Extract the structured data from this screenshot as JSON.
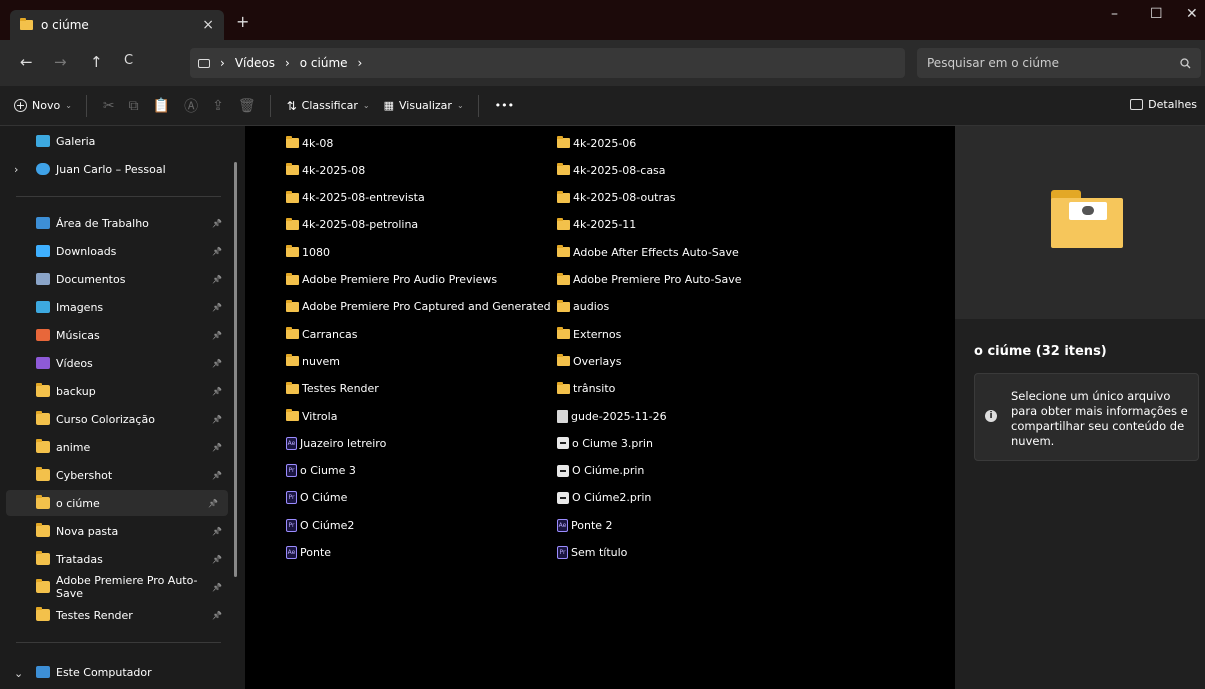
{
  "window": {
    "tab_title": "o ciúme",
    "tab_close": "×",
    "new_tab": "+",
    "minimize": "–",
    "maximize": "☐",
    "close": "✕"
  },
  "address": {
    "back": "←",
    "forward": "→",
    "up": "↑",
    "refresh": "C",
    "crumbs": [
      "Vídeos",
      "o ciúme"
    ],
    "sep": "›",
    "search_placeholder": "Pesquisar em o ciúme"
  },
  "toolbar": {
    "new_label": "Novo",
    "sort_label": "Classificar",
    "view_label": "Visualizar",
    "more_label": "•••",
    "details_label": "Detalhes"
  },
  "sidebar": {
    "gallery": "Galeria",
    "onedrive": "Juan Carlo – Pessoal",
    "pinned": [
      {
        "label": "Área de Trabalho",
        "icon": "desktop-icon",
        "color": "#3d8fd6"
      },
      {
        "label": "Downloads",
        "icon": "download-icon",
        "color": "#3fb0ff"
      },
      {
        "label": "Documentos",
        "icon": "document-icon",
        "color": "#8aa4c8"
      },
      {
        "label": "Imagens",
        "icon": "pictures-icon",
        "color": "#3da9e0"
      },
      {
        "label": "Músicas",
        "icon": "music-icon",
        "color": "#e8673a"
      },
      {
        "label": "Vídeos",
        "icon": "videos-icon",
        "color": "#8e5ad8"
      },
      {
        "label": "backup",
        "icon": "folder-icon",
        "color": "#f3c14b"
      },
      {
        "label": "Curso Colorização",
        "icon": "folder-icon",
        "color": "#f3c14b"
      },
      {
        "label": "anime",
        "icon": "folder-icon",
        "color": "#f3c14b"
      },
      {
        "label": "Cybershot",
        "icon": "folder-icon",
        "color": "#f3c14b"
      },
      {
        "label": "o ciúme",
        "icon": "folder-icon",
        "color": "#f3c14b"
      },
      {
        "label": "Nova pasta",
        "icon": "folder-icon",
        "color": "#f3c14b"
      },
      {
        "label": "Tratadas",
        "icon": "folder-icon",
        "color": "#f3c14b"
      },
      {
        "label": "Adobe Premiere Pro Auto-Save",
        "icon": "folder-icon",
        "color": "#f3c14b"
      },
      {
        "label": "Testes Render",
        "icon": "folder-icon",
        "color": "#f3c14b"
      }
    ],
    "this_pc": "Este Computador"
  },
  "files": {
    "left": [
      {
        "name": "4k-08",
        "type": "folder"
      },
      {
        "name": "4k-2025-08",
        "type": "folder"
      },
      {
        "name": "4k-2025-08-entrevista",
        "type": "folder"
      },
      {
        "name": "4k-2025-08-petrolina",
        "type": "folder"
      },
      {
        "name": "1080",
        "type": "folder"
      },
      {
        "name": "Adobe Premiere Pro Audio Previews",
        "type": "folder"
      },
      {
        "name": "Adobe Premiere Pro Captured and Generated",
        "type": "folder"
      },
      {
        "name": "Carrancas",
        "type": "folder"
      },
      {
        "name": "nuvem",
        "type": "folder"
      },
      {
        "name": "Testes Render",
        "type": "folder"
      },
      {
        "name": "Vitrola",
        "type": "folder"
      },
      {
        "name": "Juazeiro letreiro",
        "type": "ae"
      },
      {
        "name": "o Ciume 3",
        "type": "pr"
      },
      {
        "name": "O Ciúme",
        "type": "pr"
      },
      {
        "name": "O Ciúme2",
        "type": "pr"
      },
      {
        "name": "Ponte",
        "type": "ae"
      }
    ],
    "right": [
      {
        "name": "4k-2025-06",
        "type": "folder"
      },
      {
        "name": "4k-2025-08-casa",
        "type": "folder"
      },
      {
        "name": "4k-2025-08-outras",
        "type": "folder"
      },
      {
        "name": "4k-2025-11",
        "type": "folder"
      },
      {
        "name": "Adobe After Effects Auto-Save",
        "type": "folder"
      },
      {
        "name": "Adobe Premiere Pro Auto-Save",
        "type": "folder"
      },
      {
        "name": "audios",
        "type": "folder"
      },
      {
        "name": "Externos",
        "type": "folder"
      },
      {
        "name": "Overlays",
        "type": "folder"
      },
      {
        "name": "trânsito",
        "type": "folder"
      },
      {
        "name": "gude-2025-11-26",
        "type": "doc"
      },
      {
        "name": "o Ciume 3.prin",
        "type": "prin"
      },
      {
        "name": "O Ciúme.prin",
        "type": "prin"
      },
      {
        "name": "O Ciúme2.prin",
        "type": "prin"
      },
      {
        "name": "Ponte 2",
        "type": "ae"
      },
      {
        "name": "Sem título",
        "type": "pr"
      }
    ]
  },
  "details": {
    "title": "o ciúme (32 itens)",
    "message": "Selecione um único arquivo para obter mais informações e compartilhar seu conteúdo de nuvem."
  }
}
